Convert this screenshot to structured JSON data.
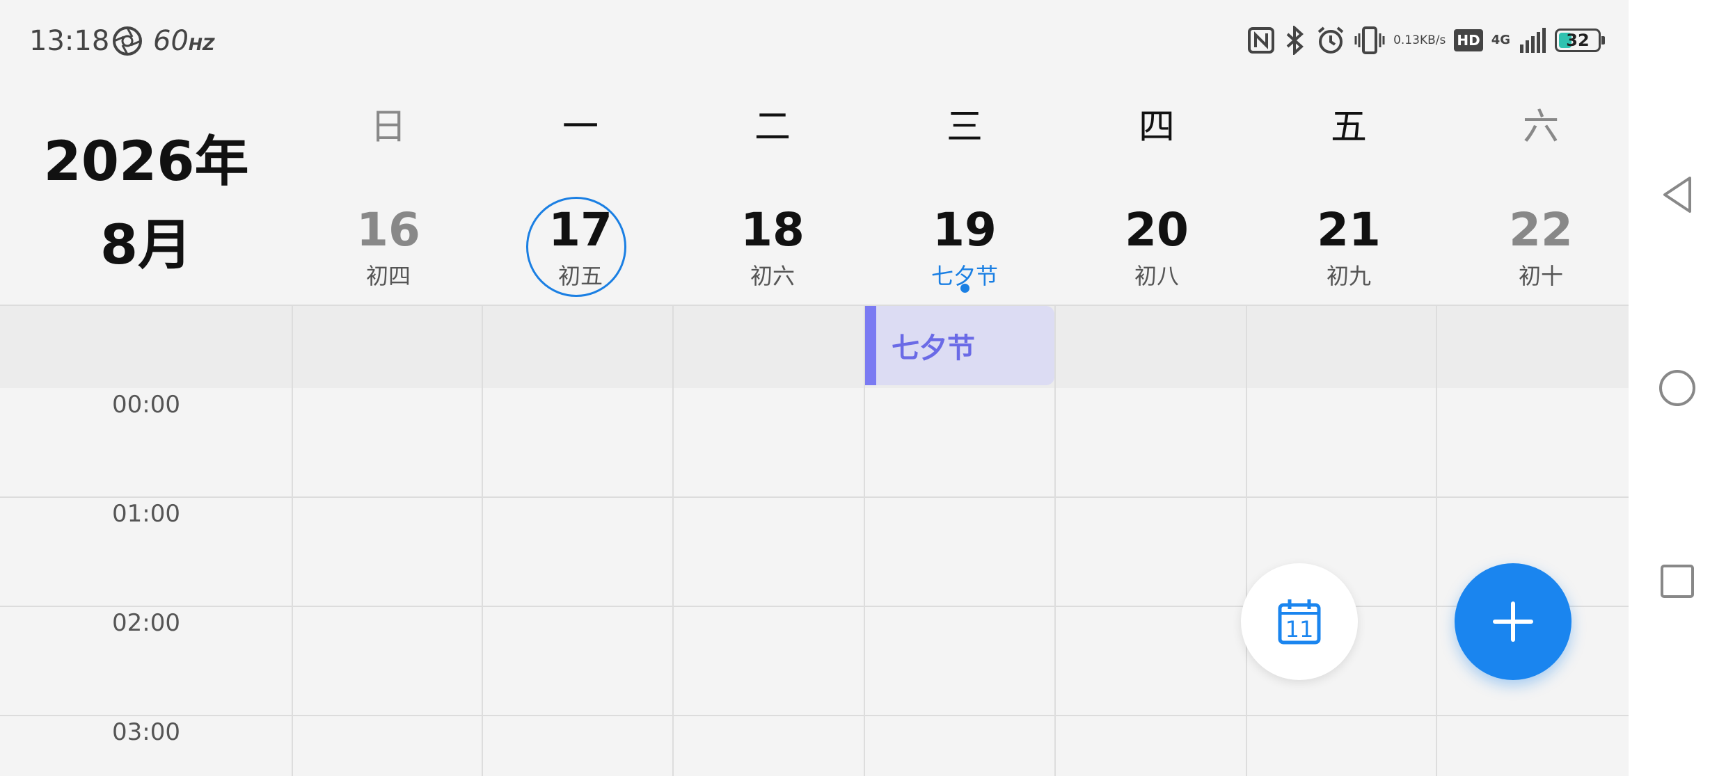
{
  "status_bar": {
    "time": "13:18",
    "refresh_rate": "60",
    "refresh_unit": "HZ",
    "net_speed_value": "0.13",
    "net_speed_unit": "KB/s",
    "hd_label": "HD",
    "network": "4G",
    "battery_level": "32",
    "battery_color": "#2fc2b0"
  },
  "header": {
    "year": "2026年",
    "month": "8月"
  },
  "week": [
    {
      "weekday": "日",
      "date": "16",
      "lunar": "初四"
    },
    {
      "weekday": "一",
      "date": "17",
      "lunar": "初五"
    },
    {
      "weekday": "二",
      "date": "18",
      "lunar": "初六"
    },
    {
      "weekday": "三",
      "date": "19",
      "lunar": "七夕节"
    },
    {
      "weekday": "四",
      "date": "20",
      "lunar": "初八"
    },
    {
      "weekday": "五",
      "date": "21",
      "lunar": "初九"
    },
    {
      "weekday": "六",
      "date": "22",
      "lunar": "初十"
    }
  ],
  "all_day_event": {
    "title": "七夕节",
    "color": "#7a7af2"
  },
  "hours": [
    "00:00",
    "01:00",
    "02:00",
    "03:00"
  ],
  "fab": {
    "today_icon_day": "11",
    "accent": "#1a85ef"
  },
  "icons": {
    "shutter": "shutter-icon",
    "nfc": "nfc-icon",
    "bluetooth": "bluetooth-icon",
    "alarm": "alarm-icon",
    "vibrate": "vibrate-icon",
    "signal": "signal-icon",
    "battery": "battery-icon",
    "today": "calendar-today-icon",
    "add": "plus-icon",
    "back": "back-triangle-icon",
    "home": "home-circle-icon",
    "recents": "recents-square-icon"
  }
}
